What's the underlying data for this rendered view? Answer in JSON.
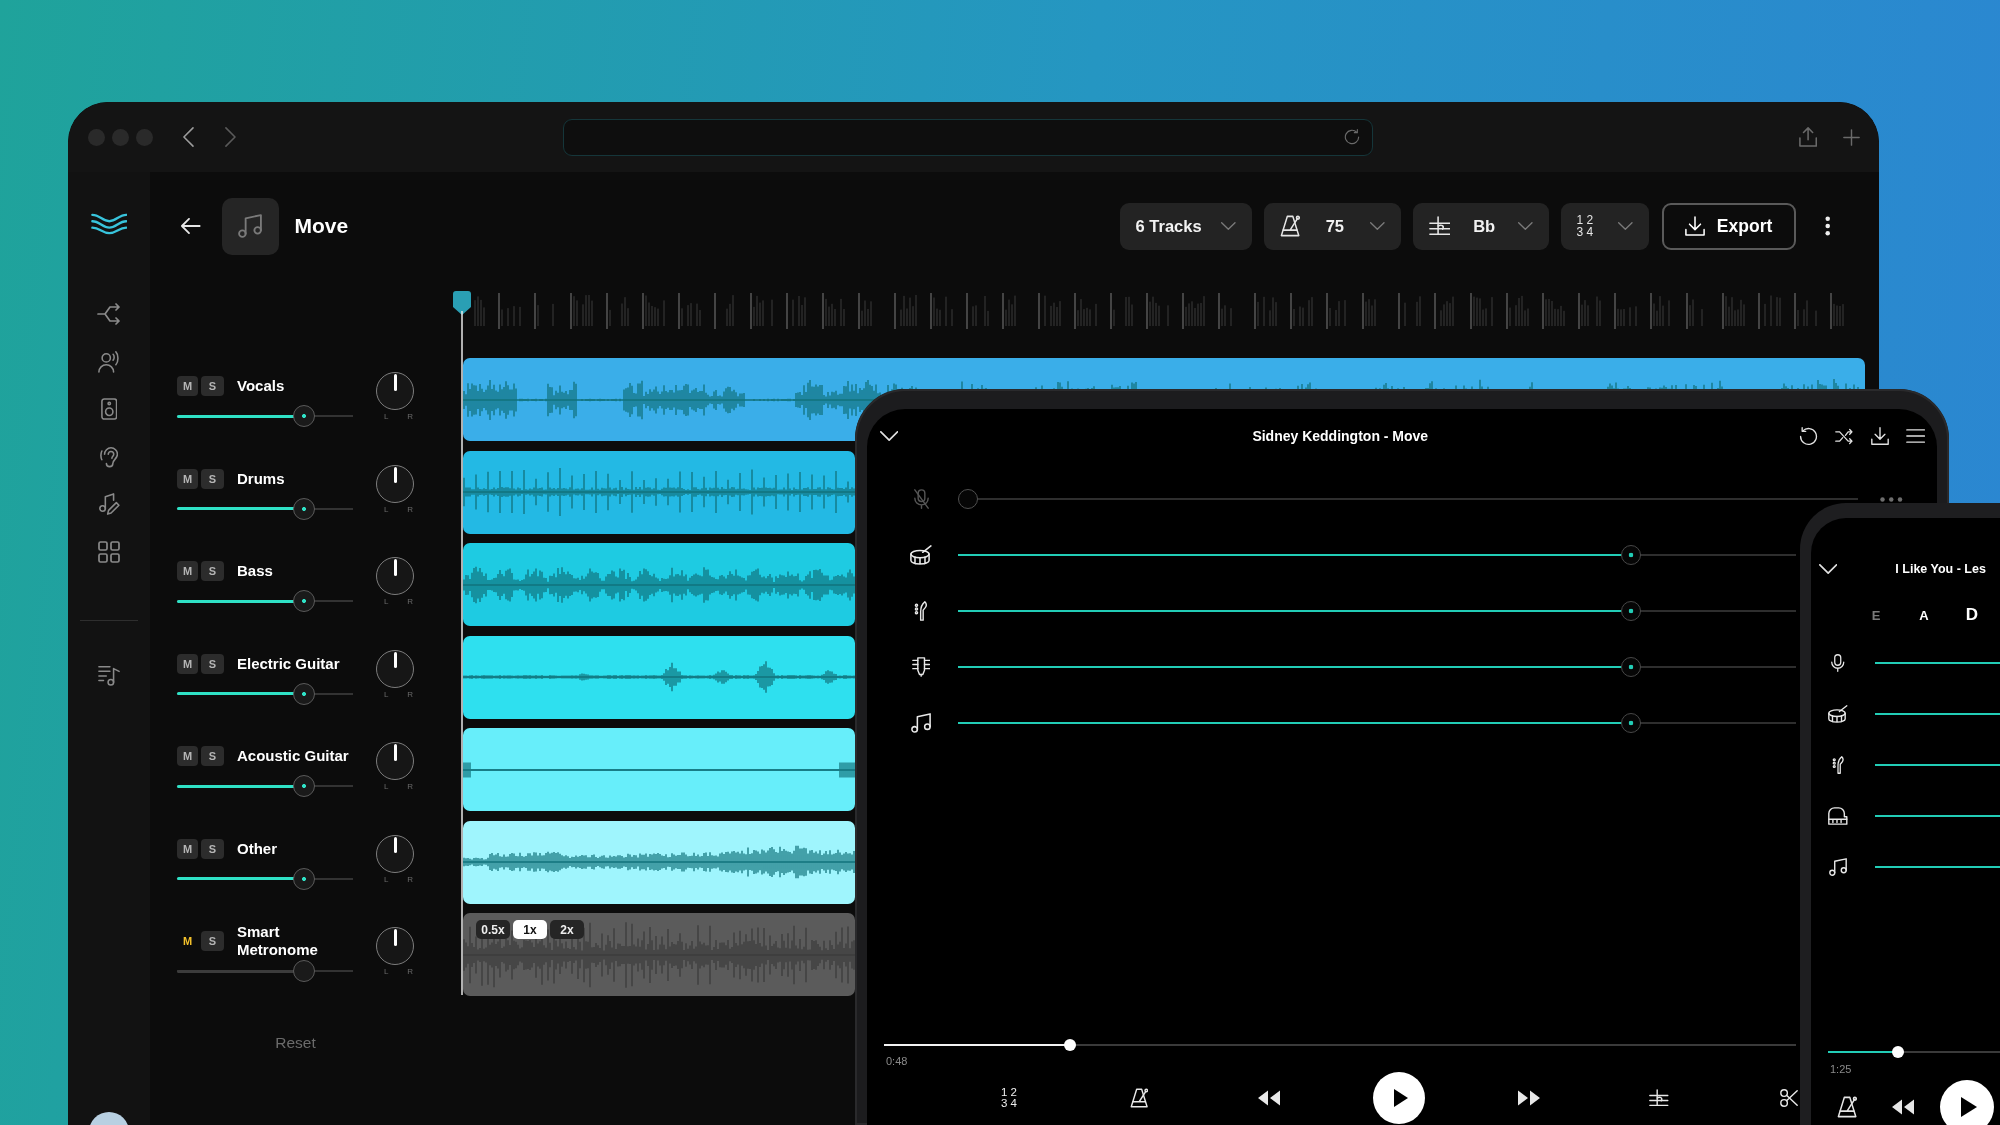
{
  "app": {
    "title": "Move",
    "toolbar": [
      {
        "kind": "tracks",
        "label": "6 Tracks"
      },
      {
        "kind": "tempo",
        "label": "75"
      },
      {
        "kind": "key",
        "label": "Bb"
      },
      {
        "kind": "time_signature",
        "lines": [
          "1 2",
          "3 4"
        ]
      }
    ],
    "export_button": "Export",
    "tracks": [
      {
        "kind": "stem",
        "name": "Vocals",
        "mute_button": {
          "label": "M",
          "on": false
        },
        "solo_button": {
          "label": "S",
          "on": false
        },
        "level": 0.75,
        "pan": {
          "level": 0.5,
          "left": "L",
          "right": "R"
        },
        "color": "#3aaee9"
      },
      {
        "kind": "stem",
        "name": "Drums",
        "mute_button": {
          "label": "M",
          "on": false
        },
        "solo_button": {
          "label": "S",
          "on": false
        },
        "level": 0.75,
        "pan": {
          "level": 0.5,
          "left": "L",
          "right": "R"
        },
        "color": "#23b9e4"
      },
      {
        "kind": "stem",
        "name": "Bass",
        "mute_button": {
          "label": "M",
          "on": false
        },
        "solo_button": {
          "label": "S",
          "on": false
        },
        "level": 0.75,
        "pan": {
          "level": 0.5,
          "left": "L",
          "right": "R"
        },
        "color": "#1ecbe2"
      },
      {
        "kind": "stem",
        "name": "Electric Guitar",
        "mute_button": {
          "label": "M",
          "on": false
        },
        "solo_button": {
          "label": "S",
          "on": false
        },
        "level": 0.75,
        "pan": {
          "level": 0.5,
          "left": "L",
          "right": "R"
        },
        "color": "#2ee0ef"
      },
      {
        "kind": "stem",
        "name": "Acoustic Guitar",
        "mute_button": {
          "label": "M",
          "on": false
        },
        "solo_button": {
          "label": "S",
          "on": false
        },
        "level": 0.75,
        "pan": {
          "level": 0.5,
          "left": "L",
          "right": "R"
        },
        "color": "#67eefa"
      },
      {
        "kind": "stem",
        "name": "Other",
        "mute_button": {
          "label": "M",
          "on": false
        },
        "solo_button": {
          "label": "S",
          "on": false
        },
        "level": 0.75,
        "pan": {
          "level": 0.5,
          "left": "L",
          "right": "R"
        },
        "color": "#9ff5fd"
      },
      {
        "kind": "metronome",
        "name": "Smart Metronome",
        "mute_button": {
          "label": "M",
          "on": true
        },
        "solo_button": {
          "label": "S",
          "on": false
        },
        "level": 0.75,
        "pan": {
          "level": 0.5,
          "left": "L",
          "right": "R"
        },
        "color": "#5b5b5b",
        "speeds": [
          {
            "label": "0.5x",
            "selected": false
          },
          {
            "label": "1x",
            "selected": true
          },
          {
            "label": "2x",
            "selected": false
          }
        ]
      }
    ],
    "reset_button": "Reset"
  },
  "tablet": {
    "title": "Sidney Keddington - Move",
    "stems": [
      {
        "kind": "vocals",
        "muted": true,
        "level": 0,
        "more": true
      },
      {
        "kind": "drums",
        "muted": false,
        "level": 0.81,
        "more": false
      },
      {
        "kind": "bass",
        "muted": false,
        "level": 0.81,
        "more": false
      },
      {
        "kind": "guitar",
        "muted": false,
        "level": 0.81,
        "more": false
      },
      {
        "kind": "other",
        "muted": false,
        "level": 0.81,
        "more": false
      }
    ],
    "progress": {
      "level": 0.2,
      "elapsed": "0:48"
    },
    "time_signature": [
      "1 2",
      "3 4"
    ]
  },
  "phone": {
    "title": "I Like You - Les",
    "chords": [
      {
        "label": "E",
        "selected": false,
        "played": true
      },
      {
        "label": "A",
        "selected": false,
        "played": false
      },
      {
        "label": "D",
        "selected": true,
        "played": false
      }
    ],
    "stems": [
      {
        "kind": "vocals",
        "muted": false,
        "level": 1
      },
      {
        "kind": "drums",
        "muted": false,
        "level": 1
      },
      {
        "kind": "bass",
        "muted": false,
        "level": 1
      },
      {
        "kind": "piano",
        "muted": false,
        "level": 1
      },
      {
        "kind": "other",
        "muted": false,
        "level": 1
      }
    ],
    "progress": {
      "level": 0.4,
      "elapsed": "1:25"
    }
  }
}
